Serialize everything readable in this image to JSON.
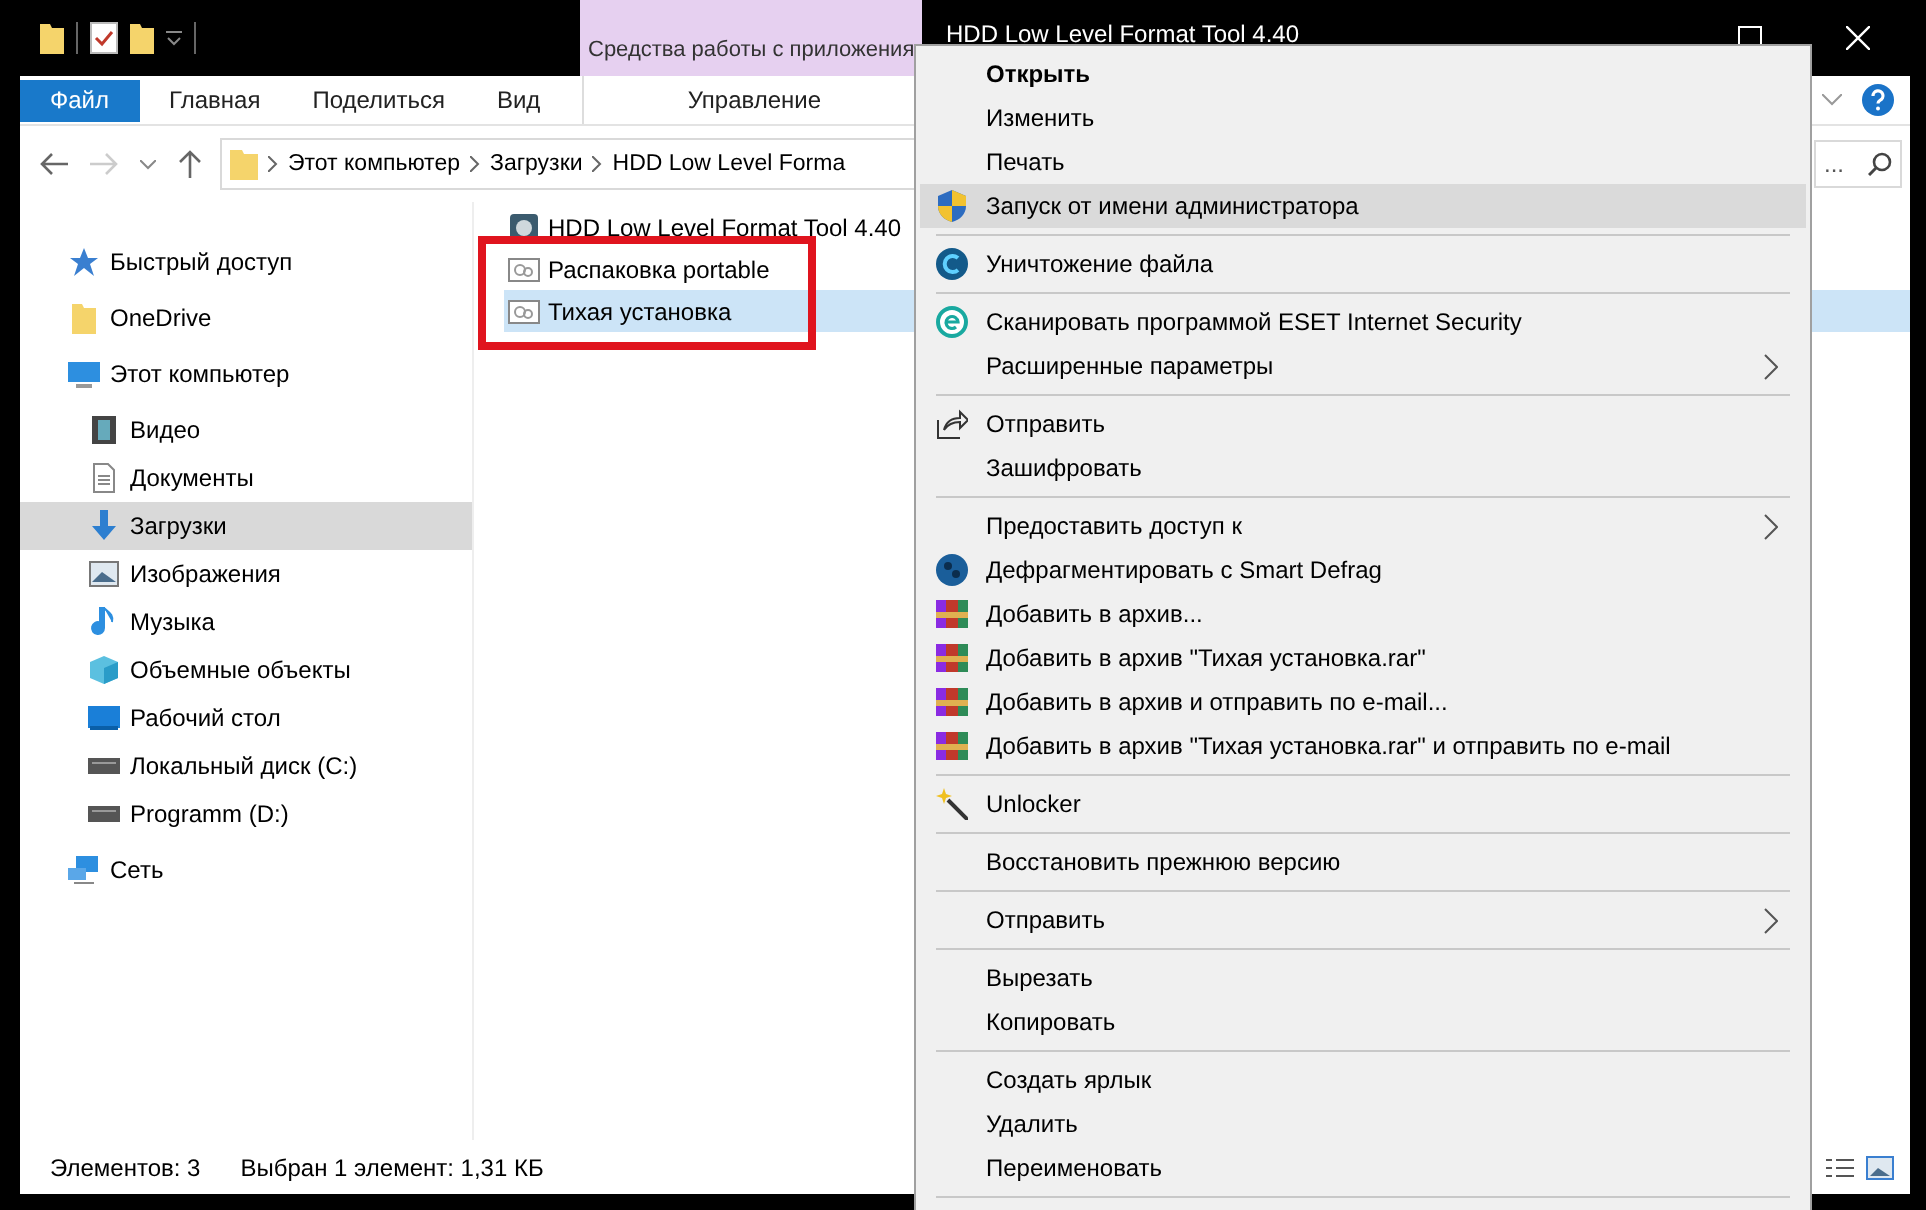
{
  "window": {
    "title": "HDD Low Level Format Tool 4.40"
  },
  "ribbon": {
    "context_group": "Средства работы с приложения",
    "tabs": [
      {
        "label": "Файл",
        "kind": "file"
      },
      {
        "label": "Главная",
        "kind": "tab"
      },
      {
        "label": "Поделиться",
        "kind": "tab"
      },
      {
        "label": "Вид",
        "kind": "tab"
      },
      {
        "label": "Управление",
        "kind": "context"
      }
    ]
  },
  "address_bar": {
    "path": [
      "Этот компьютер",
      "Загрузки",
      "HDD Low Level Forma"
    ]
  },
  "search": {
    "placeholder": "..."
  },
  "sidebar": {
    "items": [
      {
        "label": "Быстрый доступ",
        "selected": false
      },
      {
        "label": "OneDrive",
        "selected": false
      },
      {
        "label": "Этот компьютер",
        "selected": false,
        "children": [
          {
            "label": "Видео",
            "selected": false
          },
          {
            "label": "Документы",
            "selected": false
          },
          {
            "label": "Загрузки",
            "selected": true
          },
          {
            "label": "Изображения",
            "selected": false
          },
          {
            "label": "Музыка",
            "selected": false
          },
          {
            "label": "Объемные объекты",
            "selected": false
          },
          {
            "label": "Рабочий стол",
            "selected": false
          },
          {
            "label": "Локальный диск (C:)",
            "selected": false
          },
          {
            "label": "Programm (D:)",
            "selected": false
          }
        ]
      },
      {
        "label": "Сеть",
        "selected": false
      }
    ]
  },
  "files": [
    {
      "name": "HDD Low Level Format Tool 4.40",
      "selected": false
    },
    {
      "name": "Распаковка portable",
      "selected": false
    },
    {
      "name": "Тихая установка",
      "selected": true
    }
  ],
  "context_menu": {
    "items": [
      {
        "kind": "item",
        "label": "Открыть",
        "bold": true
      },
      {
        "kind": "item",
        "label": "Изменить"
      },
      {
        "kind": "item",
        "label": "Печать"
      },
      {
        "kind": "item",
        "label": "Запуск от имени администратора",
        "highlighted": true
      },
      {
        "kind": "separator"
      },
      {
        "kind": "item",
        "label": "Уничтожение файла"
      },
      {
        "kind": "separator"
      },
      {
        "kind": "item",
        "label": "Сканировать программой ESET Internet Security"
      },
      {
        "kind": "item",
        "label": "Расширенные параметры",
        "submenu": true
      },
      {
        "kind": "separator"
      },
      {
        "kind": "item",
        "label": "Отправить"
      },
      {
        "kind": "item",
        "label": "Зашифровать"
      },
      {
        "kind": "separator"
      },
      {
        "kind": "item",
        "label": "Предоставить доступ к",
        "submenu": true
      },
      {
        "kind": "item",
        "label": "Дефрагментировать с Smart Defrag"
      },
      {
        "kind": "item",
        "label": "Добавить в архив..."
      },
      {
        "kind": "item",
        "label": "Добавить в архив \"Тихая установка.rar\""
      },
      {
        "kind": "item",
        "label": "Добавить в архив и отправить по e-mail..."
      },
      {
        "kind": "item",
        "label": "Добавить в архив \"Тихая установка.rar\" и отправить по e-mail"
      },
      {
        "kind": "separator"
      },
      {
        "kind": "item",
        "label": "Unlocker"
      },
      {
        "kind": "separator"
      },
      {
        "kind": "item",
        "label": "Восстановить прежнюю версию"
      },
      {
        "kind": "separator"
      },
      {
        "kind": "item",
        "label": "Отправить",
        "submenu": true
      },
      {
        "kind": "separator"
      },
      {
        "kind": "item",
        "label": "Вырезать"
      },
      {
        "kind": "item",
        "label": "Копировать"
      },
      {
        "kind": "separator"
      },
      {
        "kind": "item",
        "label": "Создать ярлык"
      },
      {
        "kind": "item",
        "label": "Удалить"
      },
      {
        "kind": "item",
        "label": "Переименовать"
      },
      {
        "kind": "separator"
      }
    ]
  },
  "status_bar": {
    "item_count": "Элементов: 3",
    "selection": "Выбран 1 элемент: 1,31 КБ"
  }
}
